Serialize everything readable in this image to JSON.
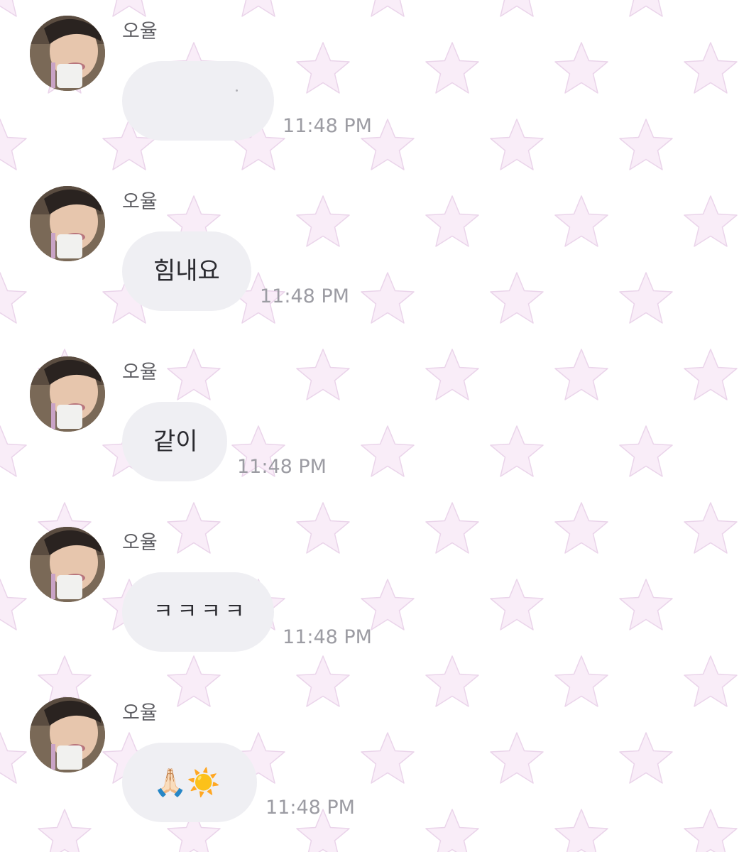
{
  "theme": {
    "background": "#ffffff",
    "star_color": "#f9edf8",
    "star_outline": "#ead4ea",
    "bubble_color": "#efeff3",
    "text_color": "#2b2b30",
    "time_color": "#9c9ca3"
  },
  "messages": [
    {
      "sender": "오율",
      "text": "",
      "time": "11:48 PM"
    },
    {
      "sender": "오율",
      "text": "힘내요",
      "time": "11:48 PM"
    },
    {
      "sender": "오율",
      "text": "같이",
      "time": "11:48 PM"
    },
    {
      "sender": "오율",
      "text": "ㅋㅋㅋㅋ",
      "time": "11:48 PM"
    },
    {
      "sender": "오율",
      "text": "🙏🏻☀️",
      "time": "11:48 PM"
    }
  ]
}
